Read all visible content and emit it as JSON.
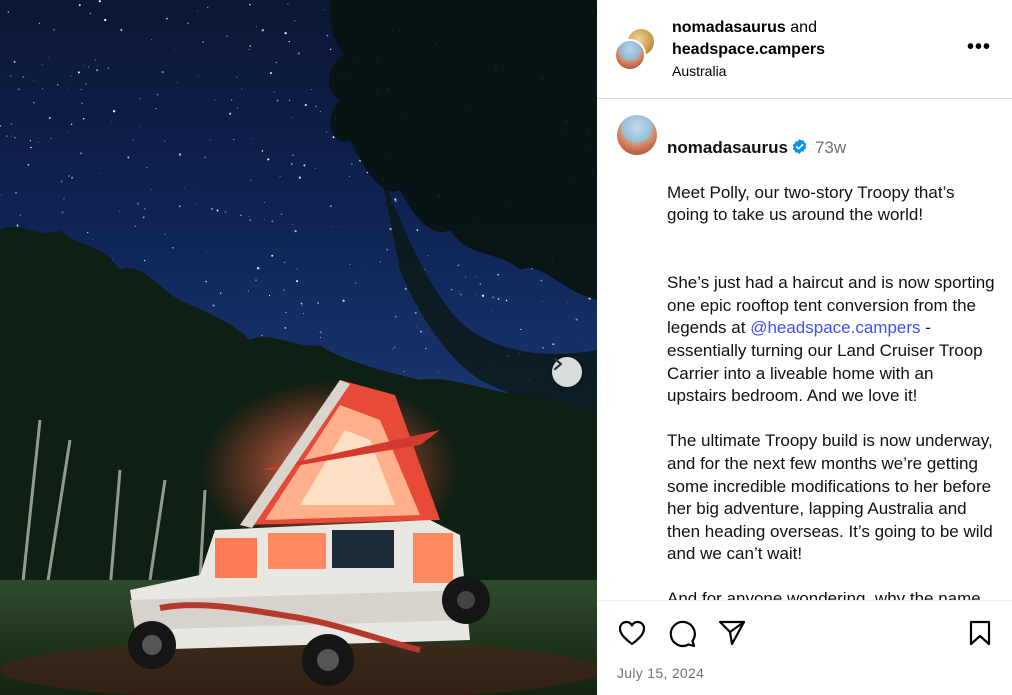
{
  "post_header": {
    "user1": "nomadasaurus",
    "conjunction": "and",
    "user2": "headspace.campers",
    "location": "Australia",
    "more_label": "•••"
  },
  "caption": {
    "username": "nomadasaurus",
    "time_ago": "73w",
    "paragraphs": [
      "Meet Polly, our two-story Troopy that’s going to take us around the world!",
      "The ultimate Troopy build is now underway, and for the next few months we’re getting some incredible modifications to her before her big adventure, lapping Australia and then heading overseas. It’s going to be wild and we can’t wait!",
      "And for anyone wondering, why the name Polly? In Swahili pole (pronounced"
    ],
    "p2_before": "She’s just had a haircut and is now sporting one epic rooftop tent conversion from the legends at ",
    "p2_mention": "@headspace.campers",
    "p2_after": " - essentially turning our Land Cruiser Troop Carrier into a liveable home with an upstairs bedroom. And we love it!"
  },
  "actions": {
    "like_icon": "heart-icon",
    "comment_icon": "comment-icon",
    "share_icon": "paper-plane-icon",
    "save_icon": "bookmark-icon"
  },
  "date": "July 15, 2024",
  "colors": {
    "mention": "#4150f7",
    "verified": "#0095f6",
    "muted": "#737373"
  }
}
